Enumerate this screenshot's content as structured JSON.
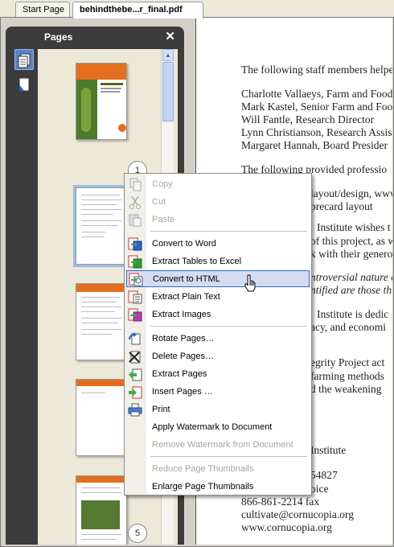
{
  "tabs": [
    "Start Page",
    "behindthebe...r_final.pdf"
  ],
  "panel": {
    "title": "Pages",
    "close": "✕"
  },
  "page_numbers": [
    "1",
    "5"
  ],
  "document_lines": [
    "The following staff members helpe",
    "Charlotte Vallaeys, Farm and Food",
    "Mark Kastel, Senior Farm and Foo",
    "Will Fantle, Research Director",
    "Lynn Christianson, Research Assis",
    "Margaret Hannah, Board Presider",
    "The following provided professio",
    "layout/design, www",
    "precard layout",
    "Institute wishes t",
    "of this project, as w",
    "k with their genero",
    "ntroversial nature o",
    "ntified are those th",
    "Institute is dedic",
    "acy, and economi",
    "egrity Project act",
    "farming methods",
    "d the weakening",
    "Institute",
    "54827",
    "oice",
    "866-861-2214 fax",
    "cultivate@cornucopia.org",
    "www.cornucopia.org"
  ],
  "menu": {
    "copy": "Copy",
    "cut": "Cut",
    "paste": "Paste",
    "convert_word": "Convert to Word",
    "extract_tables": "Extract Tables to Excel",
    "convert_html": "Convert to HTML",
    "extract_text": "Extract Plain Text",
    "extract_images": "Extract Images",
    "rotate": "Rotate Pages…",
    "delete": "Delete Pages…",
    "extract_pages": "Extract Pages",
    "insert": "Insert Pages …",
    "print": "Print",
    "apply_watermark": "Apply Watermark to Document",
    "remove_watermark": "Remove Watermark from Document",
    "reduce": "Reduce Page Thumbnails",
    "enlarge": "Enlarge Page Thumbnails"
  }
}
